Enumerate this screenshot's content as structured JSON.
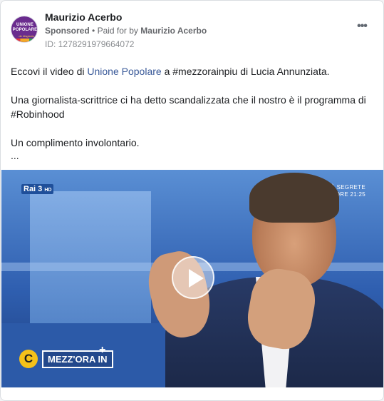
{
  "post": {
    "page_name": "Maurizio Acerbo",
    "sponsored_label": "Sponsored",
    "separator": "•",
    "paid_for_prefix": "Paid for by",
    "paid_for_name": "Maurizio Acerbo",
    "ad_id": "ID: 1278291979664072",
    "more_icon": "more-horizontal-icon",
    "avatar": {
      "line1": "UNIONE",
      "line2": "POPOLARE",
      "sub": "de Magistris"
    }
  },
  "body": {
    "p1_prefix": "Eccovi il video di",
    "p1_link": "Unione Popolare",
    "p1_suffix": "a #mezzorainpiu di Lucia Annunziata.",
    "p2": "Una giornalista-scrittrice ci ha detto scandalizzata che il nostro è il programma di #Robinhood",
    "p3": "Un complimento involontario.",
    "ellipsis": "..."
  },
  "video": {
    "channel": "Rai 3",
    "channel_hd": "HD",
    "promo_line1": "CITTÀ SEGRETE",
    "promo_line2": "QUESTA SERA ORE 21:25",
    "show_mark": "C",
    "show_title": "MEZZ'ORA IN",
    "show_plus": "+",
    "play_icon": "play-icon"
  },
  "colors": {
    "link": "#385898",
    "secondary_text": "#65676b",
    "avatar_bg": "#6a2c8e"
  }
}
